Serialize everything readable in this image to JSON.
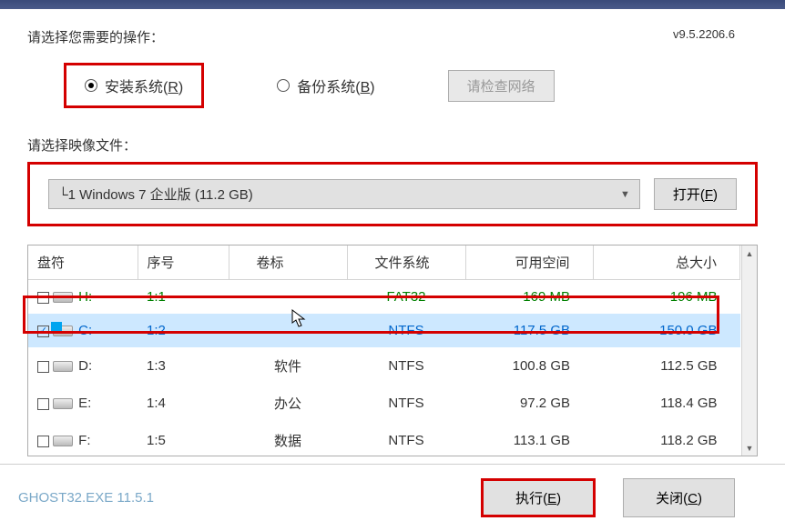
{
  "version": "v9.5.2206.6",
  "op_label": "请选择您需要的操作：",
  "install": "安装系统(",
  "install_key": "R",
  "backup": "备份系统(",
  "backup_key": "B",
  "close_paren": ")",
  "check_net": "请检查网络",
  "image_label": "请选择映像文件：",
  "image_sel": "└1 Windows 7 企业版 (11.2 GB)",
  "open": "打开(",
  "open_key": "F",
  "cols": {
    "drive": "盘符",
    "seq": "序号",
    "label": "卷标",
    "fs": "文件系统",
    "free": "可用空间",
    "total": "总大小"
  },
  "rows": [
    {
      "drive": "H:",
      "seq": "1:1",
      "label": "",
      "fs": "FAT32",
      "free": "169 MB",
      "total": "196 MB",
      "checked": false,
      "color": "green",
      "win": false
    },
    {
      "drive": "C:",
      "seq": "1:2",
      "label": "",
      "fs": "NTFS",
      "free": "117.5 GB",
      "total": "150.0 GB",
      "checked": true,
      "color": "blue",
      "win": true
    },
    {
      "drive": "D:",
      "seq": "1:3",
      "label": "软件",
      "fs": "NTFS",
      "free": "100.8 GB",
      "total": "112.5 GB",
      "checked": false,
      "color": "",
      "win": false
    },
    {
      "drive": "E:",
      "seq": "1:4",
      "label": "办公",
      "fs": "NTFS",
      "free": "97.2 GB",
      "total": "118.4 GB",
      "checked": false,
      "color": "",
      "win": false
    },
    {
      "drive": "F:",
      "seq": "1:5",
      "label": "数据",
      "fs": "NTFS",
      "free": "113.1 GB",
      "total": "118.2 GB",
      "checked": false,
      "color": "",
      "win": false
    }
  ],
  "footer_text": "GHOST32.EXE 11.5.1",
  "execute": "执行(",
  "execute_key": "E",
  "close": "关闭(",
  "close_key": "C"
}
